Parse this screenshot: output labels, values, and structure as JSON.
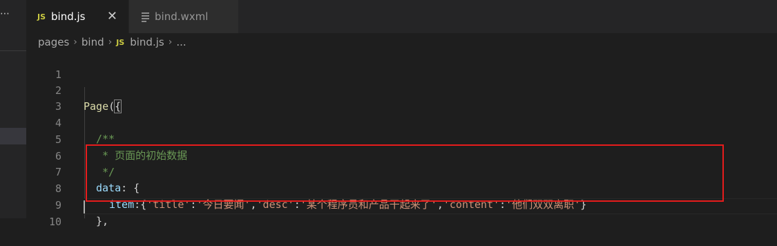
{
  "tabs": [
    {
      "badge": "JS",
      "label": "bind.js",
      "close": "✕"
    },
    {
      "label": "bind.wxml"
    }
  ],
  "breadcrumb": {
    "parts": [
      "pages",
      "bind"
    ],
    "file_badge": "JS",
    "file": "bind.js",
    "more": "..."
  },
  "editor": {
    "lines": [
      {
        "n": "1",
        "code": ""
      },
      {
        "n": "2",
        "code": "Page({"
      },
      {
        "n": "3",
        "code": ""
      },
      {
        "n": "4",
        "code": "/**"
      },
      {
        "n": "5",
        "code": " * 页面的初始数据"
      },
      {
        "n": "6",
        "code": " */"
      },
      {
        "n": "7",
        "code": "data: {"
      },
      {
        "n": "8",
        "code": "item:{'title':'今日要闻','desc':'某个程序员和产品干起来了','content':'他们双双离职'}"
      },
      {
        "n": "9",
        "code": "},"
      },
      {
        "n": "10",
        "code": ""
      }
    ],
    "tokens": {
      "l2_fn": "Page",
      "l2_paren": "(",
      "l2_brace": "{",
      "l4": "/**",
      "l5": " * 页面的初始数据",
      "l6": " */",
      "l7_key": "data",
      "l7_rest": ": {",
      "l8_key": "item",
      "l8_p1": ":{",
      "l8_s1": "'title'",
      "l8_c1": ":",
      "l8_s2": "'今日要闻'",
      "l8_c2": ",",
      "l8_s3": "'desc'",
      "l8_c3": ":",
      "l8_s4": "'某个程序员和产品干起来了'",
      "l8_c4": ",",
      "l8_s5": "'content'",
      "l8_c5": ":",
      "l8_s6": "'他们双双离职'",
      "l8_end": "}",
      "l9": "},"
    }
  },
  "colors": {
    "highlight_border": "#e81c1c",
    "string": "#ce9178",
    "property": "#9cdcfe",
    "comment": "#6a9955",
    "function": "#dcdcaa"
  }
}
